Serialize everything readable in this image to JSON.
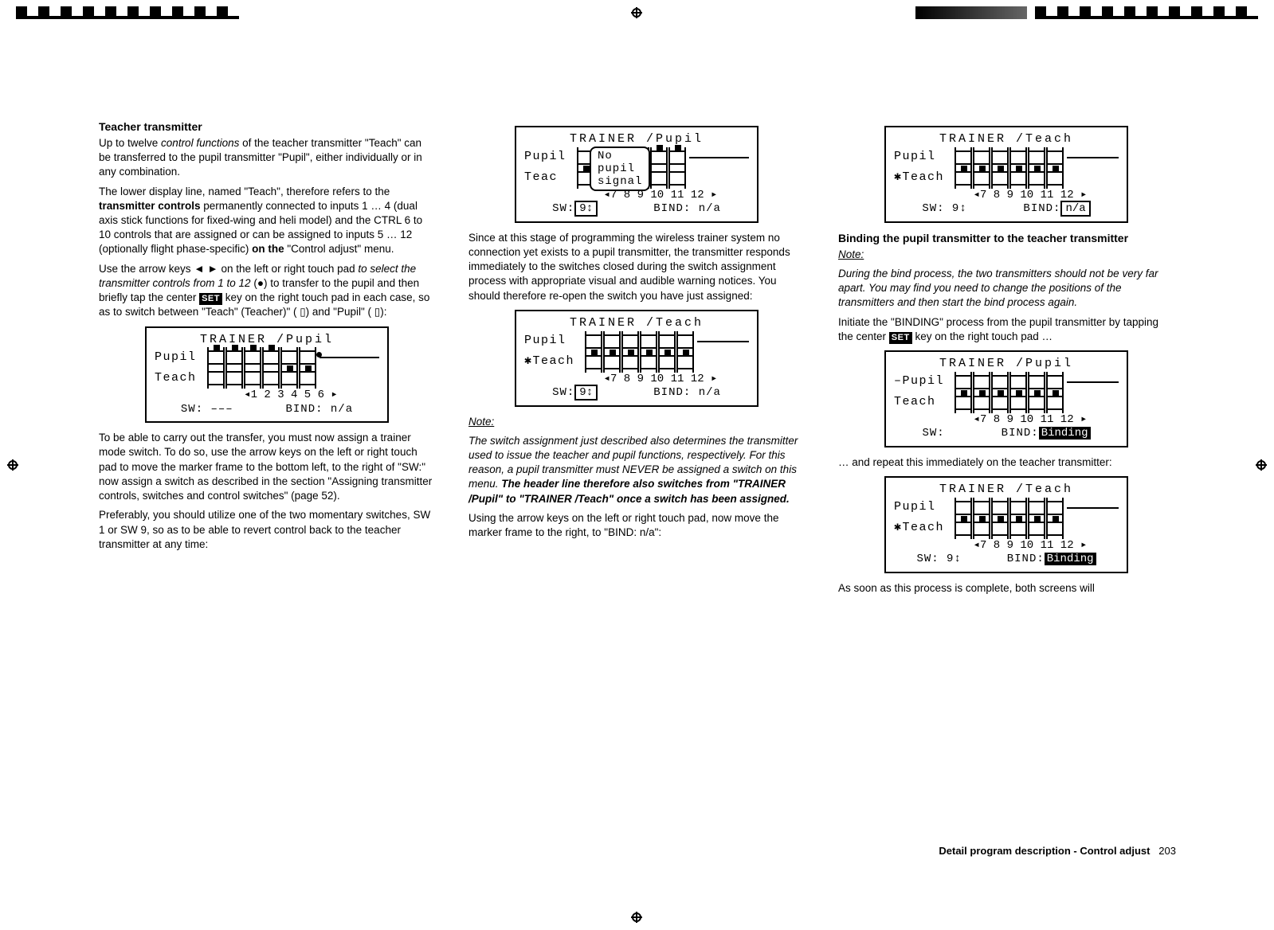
{
  "page_number": 203,
  "footer": "Detail program description - Control adjust",
  "col1": {
    "heading": "Teacher transmitter",
    "p1a": "Up to twelve ",
    "p1b": "control functions",
    "p1c": " of the teacher transmitter \"Teach\" can be transferred to the pupil transmitter \"Pupil\", either individually or in any combination.",
    "p2a": "The lower display line, named \"Teach\", therefore refers to the ",
    "p2b": "transmitter controls",
    "p2c": " permanently connected to inputs 1 … 4 (dual axis stick functions for fixed-wing and heli model) and the CTRL 6 to 10 controls that are assigned or can be assigned to inputs 5 … 12 (optionally flight phase-specific) ",
    "p2d": "on the",
    "p2e": " \"Control adjust\" menu.",
    "p3a": "Use the arrow keys ◄ ► on the left or right touch pad ",
    "p3b": "to select the transmitter controls from 1 to 12",
    "p3c": " (●) to transfer to the pupil and then briefly tap the center ",
    "p3d": "SET",
    "p3e": " key on the right touch pad in each case, so as to switch between \"Teach\" (Teacher)\" (   ▯) and \"Pupil\" (   ▯):",
    "p4": "To be able to carry out the transfer, you must now assign a trainer mode switch. To do so, use the arrow keys on the left or right touch pad to move the marker frame to the bottom left, to the right of \"SW:\" now assign a switch as described in the section \"Assigning transmitter controls, switches and control switches\" (page 52).",
    "p5": "Preferably, you should utilize one of the two momentary switches, SW 1 or SW 9, so as to be able to revert control back to the teacher transmitter at any time:"
  },
  "col2": {
    "p1": "Since at this stage of programming the wireless trainer system no connection yet exists to a pupil transmitter, the transmitter responds immediately to the switches closed during the switch assignment process with appropriate visual and audible warning notices. You should therefore re-open the switch you have just assigned:",
    "note_lbl": "Note:",
    "note_a": "The switch assignment just described also determines the transmitter used to issue the teacher and pupil functions, respectively. For this reason, a pupil transmitter must NEVER be assigned a switch on this menu. ",
    "note_b": "The header line therefore also switches from \"TRAINER /Pupil\" to \"TRAINER /Teach\" once a switch has been assigned.",
    "p2": "Using the arrow keys on the left or right touch pad, now move the marker frame to the right, to \"BIND: n/a\":"
  },
  "col3": {
    "heading": "Binding the pupil transmitter to the teacher transmitter",
    "note_lbl": "Note:",
    "note": "During the bind process, the two transmitters should not be very far apart. You may find you need to change the positions of the transmitters and then start the bind process again.",
    "p1a": "Initiate the \"BINDING\" process from the pupil transmitter by tapping the center ",
    "p1b": "SET",
    "p1c": " key on the right touch pad …",
    "p2": "… and repeat this immediately on the teacher transmitter:",
    "p3": "As soon as this process is complete, both screens will"
  },
  "lcd1": {
    "title": "TRAINER /Pupil",
    "r1": "Pupil",
    "r2": "Teach",
    "nums": "◂1  2  3  4  5  6 ▸",
    "bot_l": "SW: –––",
    "bot_r": "BIND:    n/a"
  },
  "lcd2": {
    "title": "TRAINER /Pupil",
    "r1": "Pupil",
    "r2": "Teac",
    "overlay1": "No",
    "overlay2": "pupil",
    "overlay3": "signal",
    "nums": "◂7  8  9 10 11 12 ▸",
    "bot_l": "SW:",
    "bot_sw": "9↕",
    "bot_r": "BIND:    n/a"
  },
  "lcd3": {
    "title": "TRAINER /Teach",
    "r1": "Pupil",
    "r2": "✱Teach",
    "nums": "◂7  8  9 10 11 12 ▸",
    "bot_l": "SW:",
    "bot_sw": "9↕",
    "bot_r": "BIND:    n/a"
  },
  "lcd4": {
    "title": "TRAINER /Teach",
    "r1": "Pupil",
    "r2": "✱Teach",
    "nums": "◂7  8  9 10 11 12 ▸",
    "bot_l": "SW:  9↕",
    "bot_r": "BIND:",
    "bot_box": "n/a"
  },
  "lcd5": {
    "title": "TRAINER /Pupil",
    "r1": "–Pupil",
    "r2": " Teach",
    "nums": "◂7  8  9 10 11 12 ▸",
    "bot_l": "SW:",
    "bot_r": "BIND:",
    "bot_inv": "Binding"
  },
  "lcd6": {
    "title": "TRAINER /Teach",
    "r1": "Pupil",
    "r2": "✱Teach",
    "nums": "◂7  8  9 10 11 12 ▸",
    "bot_l": "SW:  9↕",
    "bot_r": "BIND:",
    "bot_inv": "Binding"
  }
}
